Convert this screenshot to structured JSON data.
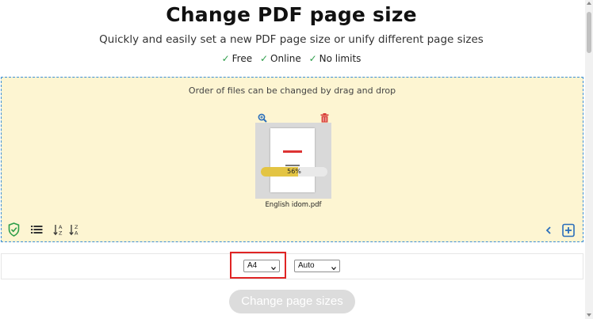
{
  "header": {
    "title": "Change PDF page size",
    "subtitle": "Quickly and easily set a new PDF page size or unify different page sizes",
    "features": [
      {
        "check": "✓",
        "label": "Free"
      },
      {
        "check": "✓",
        "label": "Online"
      },
      {
        "check": "✓",
        "label": "No limits"
      }
    ]
  },
  "dropzone": {
    "hint": "Order of files can be changed by drag and drop",
    "file": {
      "name": "English idom.pdf",
      "progress_percent": 56,
      "progress_label": "56%",
      "zoom_icon": "zoom-in-icon",
      "delete_icon": "trash-icon"
    },
    "toolbar_left_icons": [
      "shield-check-icon",
      "list-view-icon",
      "sort-az-icon",
      "sort-za-icon"
    ],
    "toolbar_right_icons": [
      "chevron-left-icon",
      "add-file-icon"
    ]
  },
  "settings": {
    "page_size": {
      "selected": "A4"
    },
    "orientation": {
      "selected": "Auto"
    }
  },
  "submit": {
    "label": "Change page sizes"
  },
  "colors": {
    "dropzone_bg": "#fdf5d2",
    "dropzone_border": "#3c8fd6",
    "check_green": "#2e9e4a",
    "progress_fill": "#e3c443",
    "highlight_red": "#e02424",
    "delete_red": "#d9403a",
    "icon_blue": "#2a6ebb"
  }
}
